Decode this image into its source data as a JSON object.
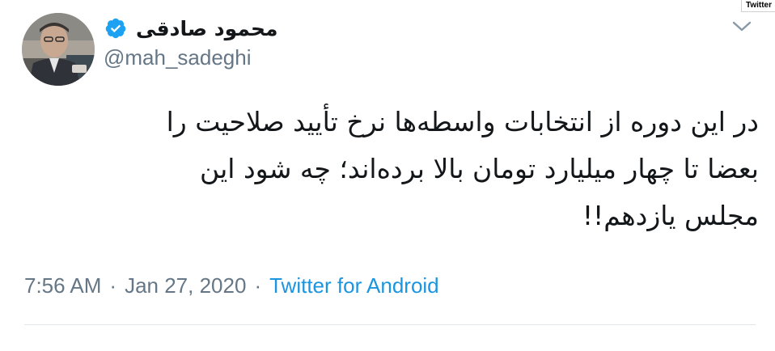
{
  "watermark": "Twitter",
  "user": {
    "display_name": "محمود صادقی",
    "handle": "@mah_sadeghi",
    "verified": true
  },
  "tweet": {
    "text": "در این دوره از انتخابات واسطه‌ها نرخ تأیید صلاحیت را\nبعضا تا چهار میلیارد تومان بالا برده‌اند؛ چه شود این\nمجلس یازدهم!!",
    "time": "7:56 AM",
    "separator": "·",
    "date": "Jan 27, 2020",
    "source": "Twitter for Android"
  },
  "icons": {
    "verified": "verified-badge-icon",
    "caret": "chevron-down-icon"
  },
  "colors": {
    "name": "#14171a",
    "secondary": "#657786",
    "link": "#1b95e0",
    "verified": "#1da1f2",
    "divider": "#e1e8ed"
  }
}
